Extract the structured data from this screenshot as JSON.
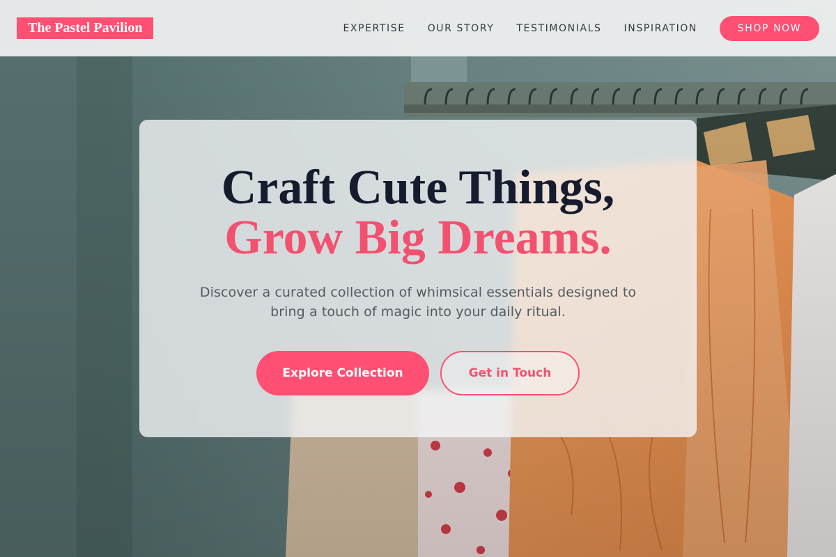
{
  "brand": {
    "name": "The Pastel Pavilion",
    "accent_color": "#ff4f73"
  },
  "nav": {
    "items": [
      "EXPERTISE",
      "OUR STORY",
      "TESTIMONIALS",
      "INSPIRATION"
    ],
    "cta_label": "SHOP NOW"
  },
  "hero": {
    "headline_line1": "Craft Cute Things,",
    "headline_line2": "Grow Big Dreams.",
    "subtext": "Discover a curated collection of whimsical essentials designed to bring a touch of magic into your daily ritual.",
    "primary_cta": "Explore Collection",
    "secondary_cta": "Get in Touch",
    "background_image": "clothing-rack-photo"
  }
}
